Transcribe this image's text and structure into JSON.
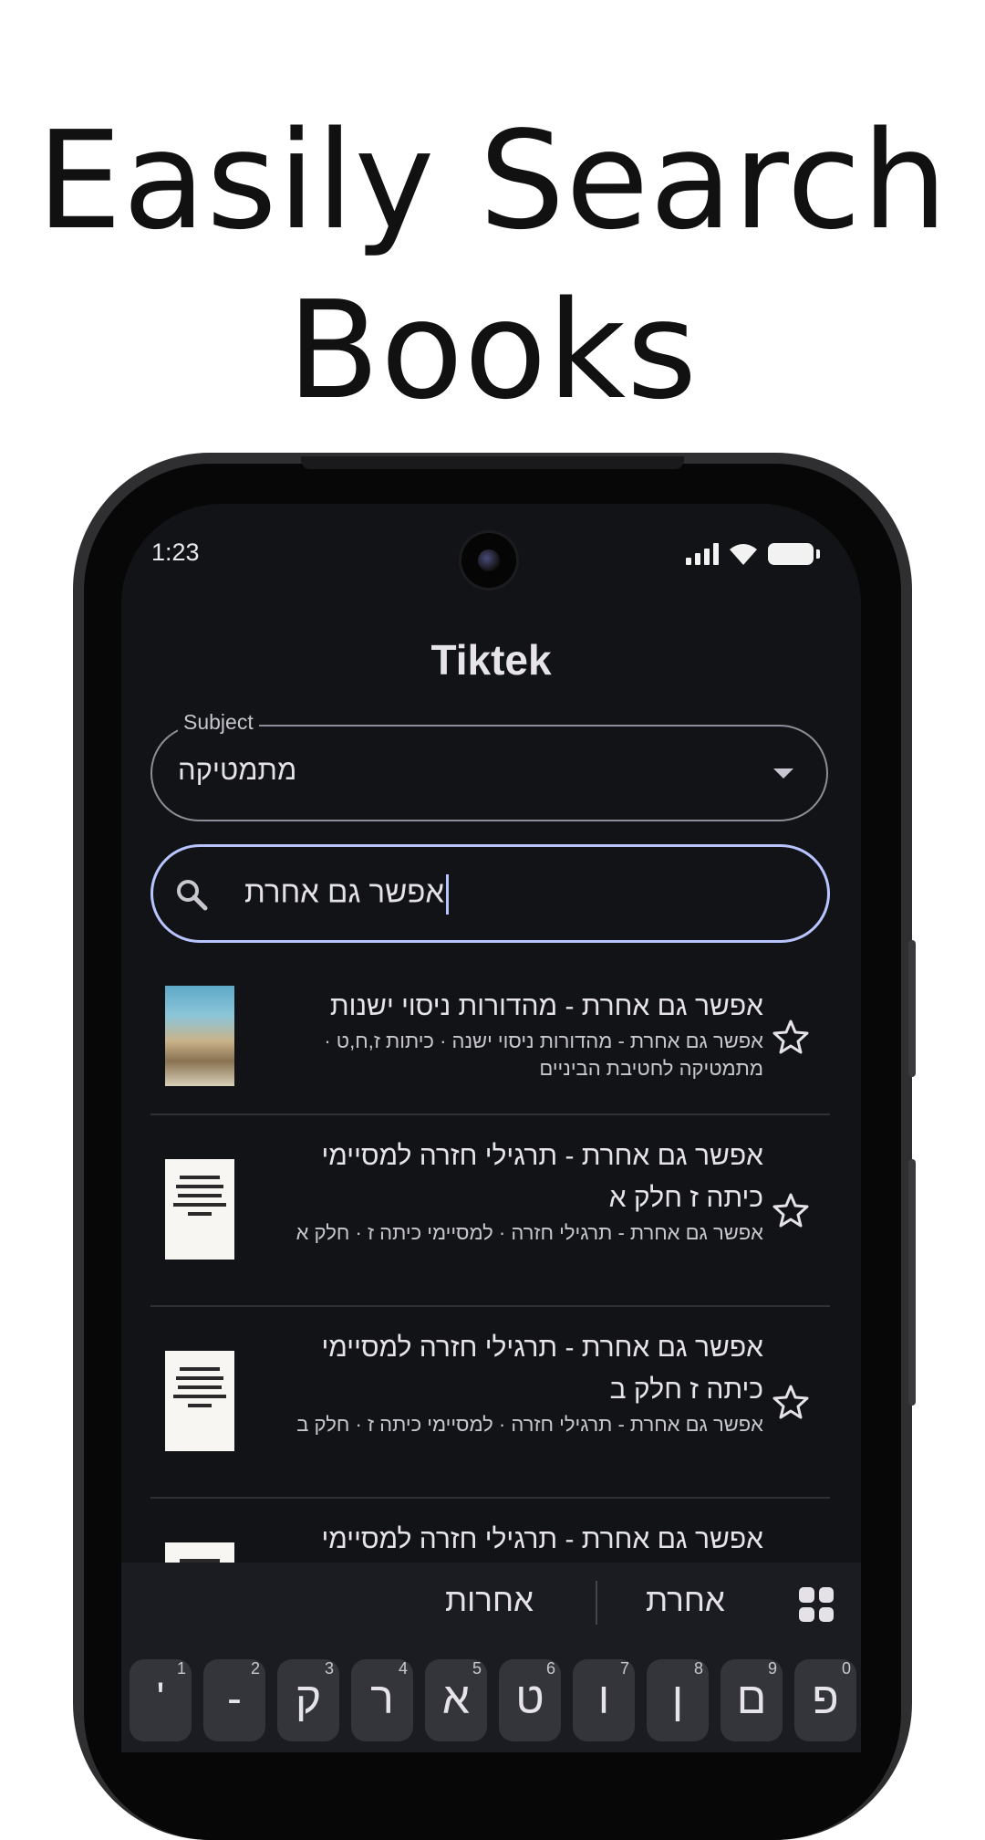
{
  "headline": {
    "line1": "Easily Search",
    "line2": "Books"
  },
  "status_bar": {
    "time": "1:23"
  },
  "app": {
    "title": "Tiktek"
  },
  "subject": {
    "label": "Subject",
    "value": "מתמטיקה"
  },
  "search": {
    "value": "אפשר גם אחרת"
  },
  "results": [
    {
      "title": "אפשר גם אחרת - מהדורות ניסוי ישנות",
      "subtitle": "אפשר גם אחרת - מהדורות ניסוי ישנה · כיתות ז,ח,ט · מתמטיקה לחטיבת הביניים"
    },
    {
      "title": "אפשר גם אחרת - תרגילי חזרה למסיימי כיתה ז חלק א",
      "subtitle": "אפשר גם אחרת - תרגילי חזרה · למסיימי כיתה ז · חלק א"
    },
    {
      "title": "אפשר גם אחרת - תרגילי חזרה למסיימי כיתה ז חלק ב",
      "subtitle": "אפשר גם אחרת - תרגילי חזרה · למסיימי כיתה ז · חלק ב"
    },
    {
      "title": "אפשר גם אחרת - תרגילי חזרה למסיימי"
    }
  ],
  "keyboard": {
    "suggestions": [
      "אחרות",
      "אחרת"
    ],
    "keys": [
      {
        "char": "'",
        "num": "1"
      },
      {
        "char": "-",
        "num": "2"
      },
      {
        "char": "ק",
        "num": "3"
      },
      {
        "char": "ר",
        "num": "4"
      },
      {
        "char": "א",
        "num": "5"
      },
      {
        "char": "ט",
        "num": "6"
      },
      {
        "char": "ו",
        "num": "7"
      },
      {
        "char": "ן",
        "num": "8"
      },
      {
        "char": "ם",
        "num": "9"
      },
      {
        "char": "פ",
        "num": "0"
      }
    ]
  },
  "colors": {
    "screen_bg": "#121316",
    "accent": "#b8c4ff",
    "divider": "#2f3036"
  }
}
